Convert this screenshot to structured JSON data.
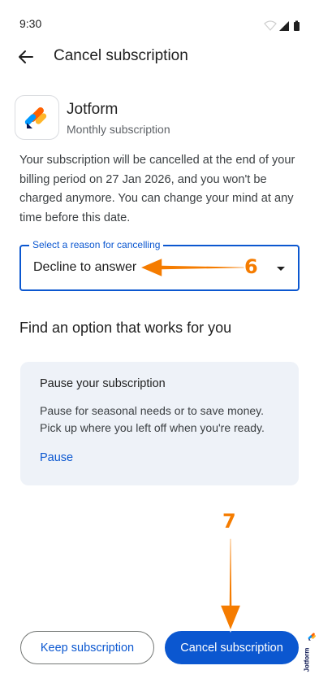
{
  "status_bar": {
    "time": "9:30",
    "icons": [
      "wifi-icon",
      "signal-icon",
      "battery-icon"
    ]
  },
  "header": {
    "back_icon": "arrow-back-icon",
    "title": "Cancel subscription"
  },
  "app": {
    "name": "Jotform",
    "plan": "Monthly subscription",
    "icon": "jotform-logo-icon"
  },
  "info": {
    "text": "Your subscription will be cancelled at the end of your billing period on 27 Jan 2026, and you won't be charged anymore. You can change your mind at any time before this date."
  },
  "reason_select": {
    "label": "Select a reason for cancelling",
    "selected": "Decline to answer"
  },
  "options": {
    "heading": "Find an option that works for you",
    "pause_card": {
      "title": "Pause your subscription",
      "description": "Pause for seasonal needs or to save money. Pick up where you left off when you're ready.",
      "action": "Pause"
    }
  },
  "footer": {
    "keep_label": "Keep subscription",
    "cancel_label": "Cancel subscription"
  },
  "annotations": {
    "step_6": "6",
    "step_7": "7",
    "arrow_color": "#f57c00"
  },
  "watermark": {
    "text": "Jotform"
  },
  "colors": {
    "accent": "#0b57d0",
    "card_bg": "#eef2f8"
  }
}
